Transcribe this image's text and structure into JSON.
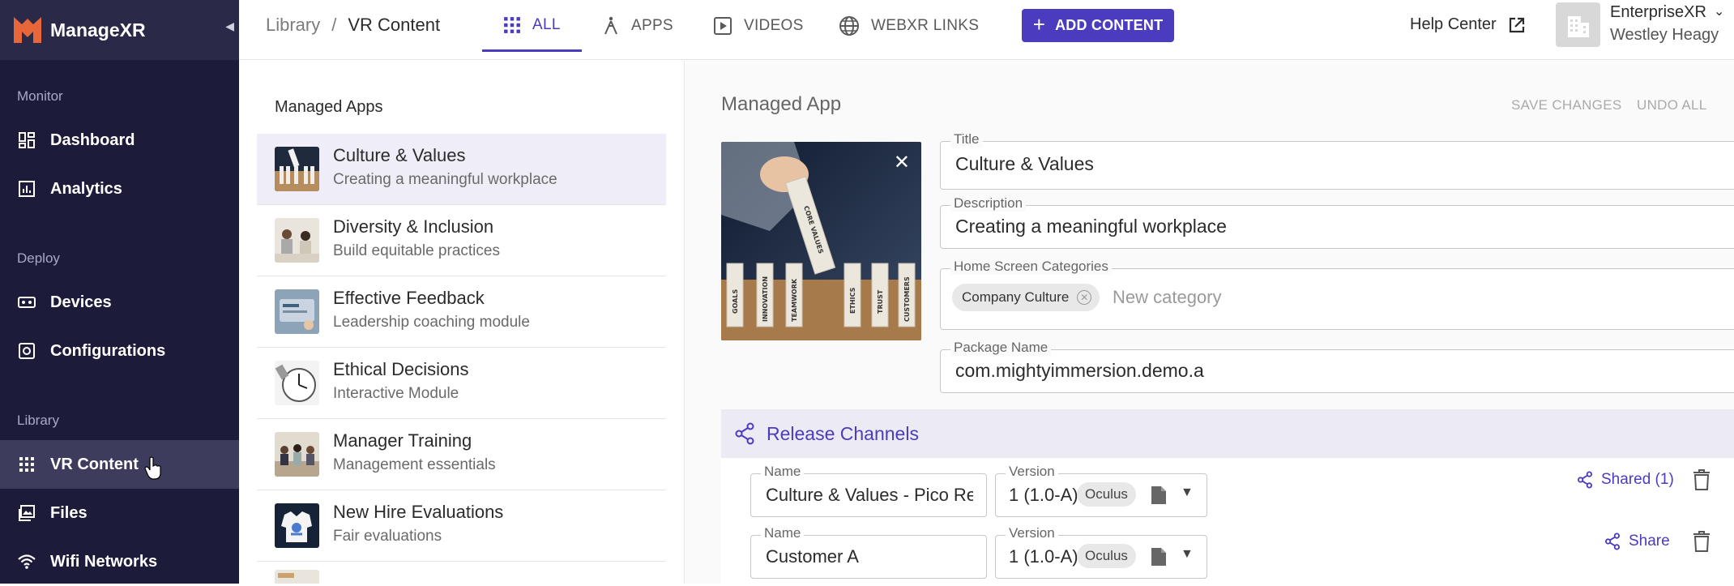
{
  "app": {
    "name": "ManageXR"
  },
  "sidebar": {
    "sections": [
      {
        "label": "Monitor"
      },
      {
        "label": "Deploy"
      },
      {
        "label": "Library"
      }
    ],
    "items": [
      {
        "label": "Dashboard",
        "icon": "dashboard-icon"
      },
      {
        "label": "Analytics",
        "icon": "analytics-icon"
      },
      {
        "label": "Devices",
        "icon": "devices-icon"
      },
      {
        "label": "Configurations",
        "icon": "configurations-icon"
      },
      {
        "label": "VR Content",
        "icon": "grid-icon",
        "active": true
      },
      {
        "label": "Files",
        "icon": "files-icon"
      },
      {
        "label": "Wifi Networks",
        "icon": "wifi-icon"
      }
    ]
  },
  "header": {
    "breadcrumb": {
      "root": "Library",
      "sep": "/",
      "current": "VR Content"
    },
    "tabs": [
      {
        "label": "ALL",
        "icon": "grid-icon",
        "active": true
      },
      {
        "label": "APPS",
        "icon": "app-icon"
      },
      {
        "label": "VIDEOS",
        "icon": "video-icon"
      },
      {
        "label": "WEBXR LINKS",
        "icon": "globe-icon"
      }
    ],
    "add_button": "ADD CONTENT",
    "help": "Help Center",
    "org": "EnterpriseXR",
    "user": "Westley Heagy"
  },
  "list": {
    "heading": "Managed Apps",
    "items": [
      {
        "title": "Culture & Values",
        "subtitle": "Creating a meaningful workplace",
        "selected": true
      },
      {
        "title": "Diversity & Inclusion",
        "subtitle": "Build equitable practices"
      },
      {
        "title": "Effective Feedback",
        "subtitle": "Leadership coaching module"
      },
      {
        "title": "Ethical Decisions",
        "subtitle": "Interactive Module"
      },
      {
        "title": "Manager Training",
        "subtitle": "Management essentials"
      },
      {
        "title": "New Hire Evaluations",
        "subtitle": "Fair evaluations"
      }
    ]
  },
  "detail": {
    "heading": "Managed App",
    "save": "SAVE CHANGES",
    "undo": "UNDO ALL",
    "image_blocks": [
      "GOALS",
      "INNOVATION",
      "TEAMWORK",
      "ETHICS",
      "TRUST",
      "CUSTOMERS"
    ],
    "image_hand_block": "CORE VALUES",
    "fields": {
      "title": {
        "label": "Title",
        "value": "Culture & Values"
      },
      "description": {
        "label": "Description",
        "value": "Creating a meaningful workplace"
      },
      "categories": {
        "label": "Home Screen Categories",
        "chip": "Company Culture",
        "placeholder": "New category"
      },
      "package": {
        "label": "Package Name",
        "value": "com.mightyimmersion.demo.a"
      }
    },
    "release": {
      "heading": "Release Channels",
      "channels": [
        {
          "name_label": "Name",
          "name": "Culture & Values - Pico Release",
          "version_label": "Version",
          "version": "1 (1.0-A)",
          "platform": "Oculus",
          "share": "Shared (1)"
        },
        {
          "name_label": "Name",
          "name": "Customer A",
          "version_label": "Version",
          "version": "1 (1.0-A)",
          "platform": "Oculus",
          "share": "Share"
        }
      ]
    }
  },
  "colors": {
    "accent": "#4a3bbf",
    "sidebar": "#1d1b3a",
    "logo": "#e8673a"
  }
}
